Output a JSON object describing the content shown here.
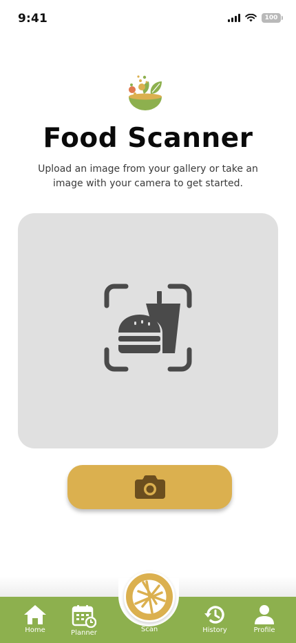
{
  "status_bar": {
    "time": "9:41",
    "battery": "100",
    "icons": [
      "cellular-signal-icon",
      "wifi-icon",
      "battery-icon"
    ]
  },
  "header": {
    "logo_icon": "salad-bowl-logo-icon",
    "title": "Food Scanner",
    "subtitle": "Upload an image from your gallery or take an image with your camera to get started."
  },
  "scan_area": {
    "icon": "food-scan-icon"
  },
  "camera_button": {
    "icon": "camera-icon"
  },
  "bottom_nav": {
    "items": [
      {
        "label": "Home",
        "icon": "home-icon"
      },
      {
        "label": "Planner",
        "icon": "calendar-icon"
      },
      {
        "label": "Scan",
        "icon": "aperture-icon"
      },
      {
        "label": "History",
        "icon": "history-icon"
      },
      {
        "label": "Profile",
        "icon": "profile-icon"
      }
    ]
  },
  "colors": {
    "accent_gold": "#dbb04f",
    "nav_green": "#8db04e",
    "scan_area_bg": "#e0e0e0",
    "icon_dark": "#4a4a4a",
    "camera_icon": "#6b4e1e"
  }
}
